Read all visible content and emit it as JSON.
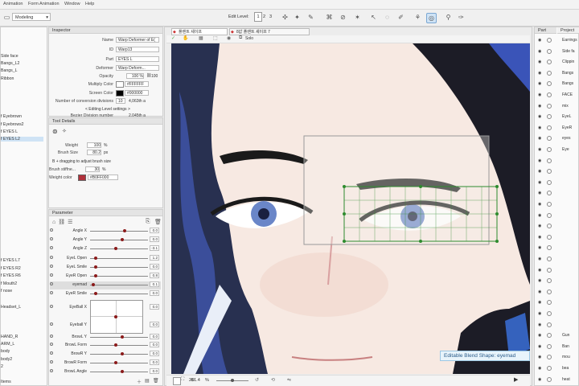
{
  "menu": [
    "Animation",
    "Form Animation",
    "Window",
    "Help"
  ],
  "mode": "Modeling",
  "edit_level": {
    "label": "Edit Level:",
    "levels": [
      "1",
      "2",
      "3"
    ]
  },
  "left_items": [
    "Side face",
    "Bangs_L2",
    "Bangs_L",
    "Ribbon",
    "f Eyebrown",
    "f Eyebrows2",
    "f EYES L",
    "f EYES L2",
    "f EYES L7",
    "f EYES R2",
    "f EYES R6",
    "f Mouth2",
    "f nose",
    "Headset_L",
    "HAND_R",
    "ARM_L",
    "body",
    "body2",
    "2",
    "Items"
  ],
  "inspector": {
    "tab": "Inspector",
    "rows": [
      {
        "label": "Name",
        "value": "Warp Deformer of E("
      },
      {
        "label": "ID",
        "value": "Warp13"
      },
      {
        "label": "Part",
        "value": "EYES L"
      },
      {
        "label": "Deformer",
        "value": "Warp Deform..."
      },
      {
        "label": "Opacity",
        "value": "100 %"
      },
      {
        "label": "Multiply Color",
        "value": "#FFFFFF"
      },
      {
        "label": "Screen Color",
        "value": "#000000"
      },
      {
        "label": "Number of conversion divisions",
        "value": "10"
      },
      {
        "label": "",
        "value": "4,063th a"
      }
    ],
    "opacity_extra": "100",
    "level_settings": "< Editing Level settings >",
    "bezier_label": "Bezier Division number",
    "bezier_value": "2,045th a"
  },
  "tool_details": {
    "tab": "Tool Details",
    "weight_label": "Weight",
    "weight_value": "100",
    "weight_unit": "%",
    "brush_label": "Brush Size",
    "brush_value": "80.2",
    "brush_unit": "px",
    "hint": "B + dragging to adjust brush size",
    "stiffness_label": "Brush stiffne...",
    "stiffness_value": "30",
    "stiffness_unit": "%",
    "color_label": "Weight color",
    "color_value": "#B0FF000"
  },
  "parameter": {
    "tab": "Parameter",
    "rows": [
      {
        "name": "Angle X",
        "value": "0.0"
      },
      {
        "name": "Angle Y",
        "value": "0.0"
      },
      {
        "name": "Angle Z",
        "value": "-3.1"
      },
      {
        "name": "EyeL Open",
        "value": "1.2"
      },
      {
        "name": "EyeL Smile",
        "value": "0.0"
      },
      {
        "name": "EyeR Open",
        "value": "0.8"
      },
      {
        "name": "eyemad",
        "value": "0.1"
      },
      {
        "name": "EyeR Smile",
        "value": "0.0"
      },
      {
        "name": "EyeBall X",
        "value": "0.0"
      },
      {
        "name": "Eyeball Y",
        "value": "0.0"
      },
      {
        "name": "BrowL Y",
        "value": "0.0"
      },
      {
        "name": "BrowL Form",
        "value": "0.0"
      },
      {
        "name": "BrowR Y",
        "value": "0.0"
      },
      {
        "name": "BrowR Form",
        "value": "0.0"
      },
      {
        "name": "BrowL Angle",
        "value": "0.0"
      }
    ]
  },
  "tabs": [
    "플랜트 셰이프",
    "8값 플랜트 셰이프 7"
  ],
  "canvas_toolbar": {
    "solo": "Solo"
  },
  "status": {
    "zoom": "261.4",
    "unit": "%"
  },
  "tooltip": "Editable Blend Shape: eyemad",
  "right_panel": {
    "tabs": [
      "Part",
      "Project"
    ],
    "items": [
      "Earrings",
      "Side fa",
      "Clippin",
      "Bangs",
      "Bangs",
      "FACE",
      "mix",
      "EyeL",
      "EyeR",
      "eyes",
      "Eye",
      "",
      "",
      "",
      "",
      "",
      "",
      "",
      "",
      "",
      "",
      "",
      "",
      "",
      "",
      "",
      "",
      "Gun",
      "Ban",
      "mou",
      "bea",
      "heat"
    ]
  },
  "colors": {
    "accent": "#1a7fd4",
    "param_knob": "#8b1a1a",
    "tooltip_bg": "#e8f4fb"
  }
}
